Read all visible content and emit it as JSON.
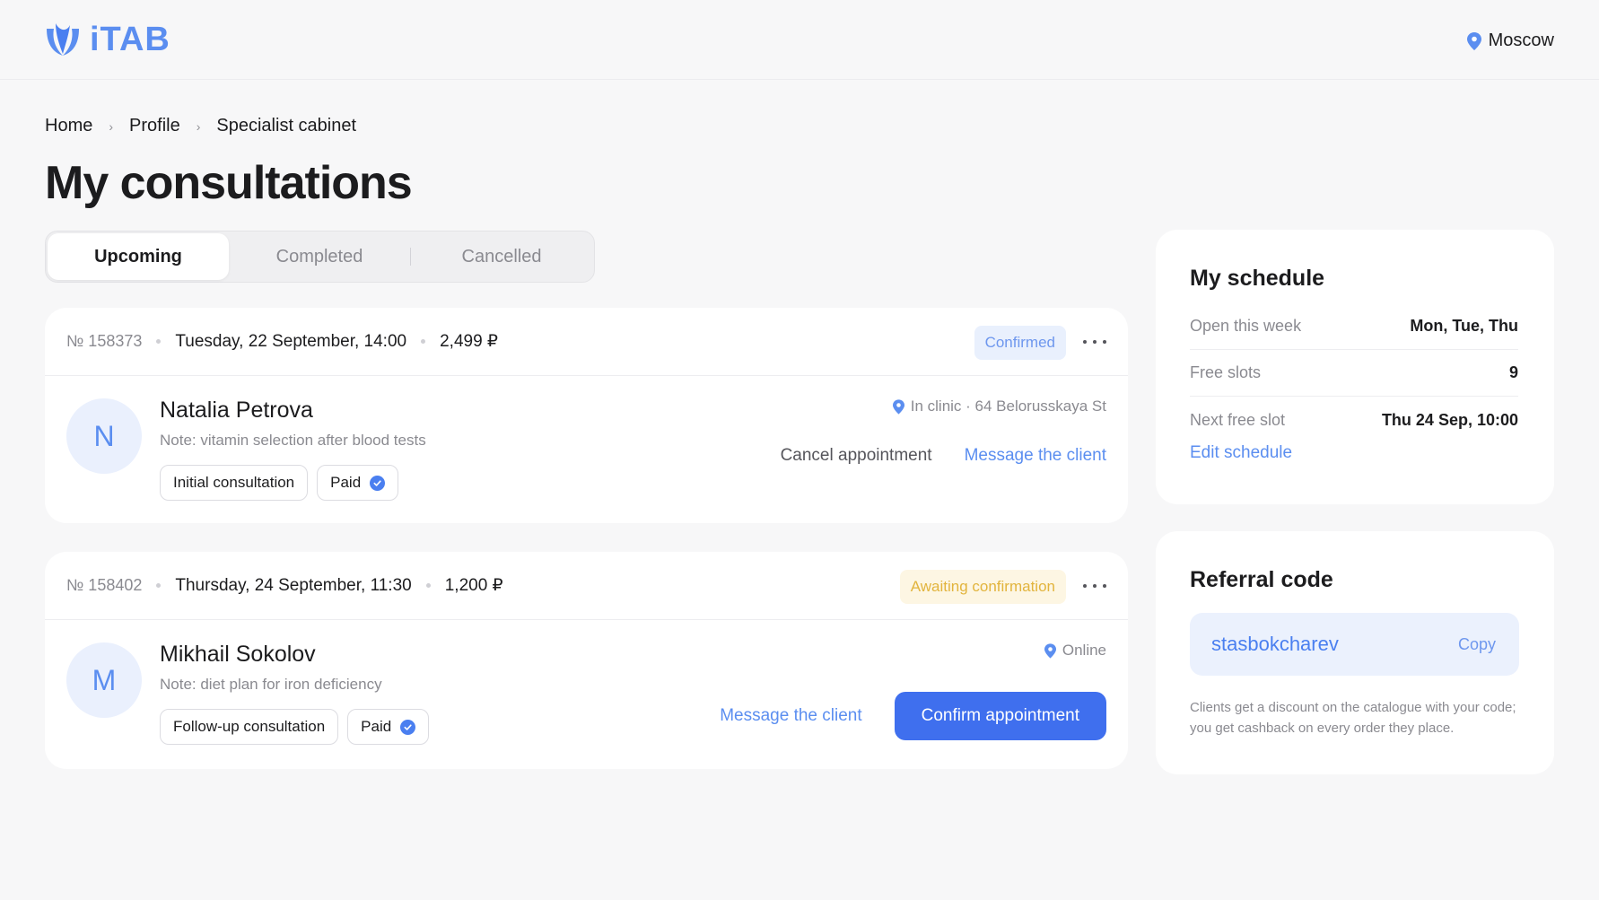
{
  "header": {
    "logo_text": "iTAB",
    "city": "Moscow"
  },
  "breadcrumb": [
    "Home",
    "Profile",
    "Specialist cabinet"
  ],
  "page_title": "My consultations",
  "tabs": [
    {
      "label": "Upcoming",
      "active": true
    },
    {
      "label": "Completed",
      "active": false
    },
    {
      "label": "Cancelled",
      "active": false
    }
  ],
  "consultations": [
    {
      "number": "№ 158373",
      "datetime": "Tuesday, 22 September, 14:00",
      "price": "2,499 ₽",
      "status": "Confirmed",
      "avatar_letter": "N",
      "client_name": "Natalia Petrova",
      "note": "Note: vitamin selection after blood tests",
      "type_chip": "Initial consultation",
      "payment_chip": "Paid",
      "location": "In clinic · 64 Belorusskaya St",
      "secondary_action": "Cancel appointment",
      "primary_action": "Message the client"
    },
    {
      "number": "№ 158402",
      "datetime": "Thursday, 24 September, 11:30",
      "price": "1,200 ₽",
      "status": "Awaiting confirmation",
      "avatar_letter": "M",
      "client_name": "Mikhail Sokolov",
      "note": "Note: diet plan for iron deficiency",
      "type_chip": "Follow-up consultation",
      "payment_chip": "Paid",
      "location": "Online",
      "secondary_action": "Message the client",
      "primary_action": "Confirm appointment"
    }
  ],
  "schedule": {
    "title": "My schedule",
    "rows": [
      {
        "label": "Open this week",
        "value": "Mon, Tue, Thu"
      },
      {
        "label": "Free slots",
        "value": "9"
      },
      {
        "label": "Next free slot",
        "value": "Thu 24 Sep, 10:00"
      }
    ],
    "edit_label": "Edit schedule"
  },
  "referral": {
    "title": "Referral code",
    "code": "stasbokcharev",
    "copy_label": "Copy",
    "description": "Clients get a discount on the catalogue with your code; you get cashback on every order they place."
  },
  "colors": {
    "accent": "#3f6fee",
    "link": "#5b8ef0",
    "confirmed_bg": "#e9f0fd",
    "awaiting_text": "#e2b43d",
    "page_bg": "#f7f7f8"
  },
  "icons": [
    "logo-icon",
    "location-pin-icon",
    "chevron-right-icon",
    "more-dots-icon",
    "check-badge-icon"
  ]
}
